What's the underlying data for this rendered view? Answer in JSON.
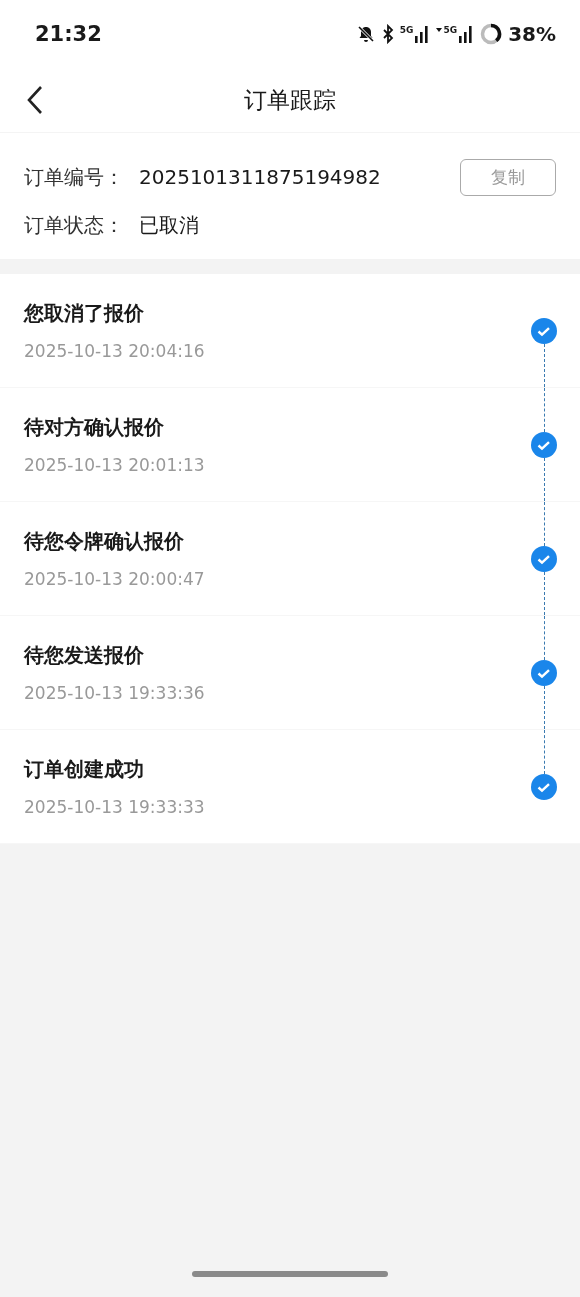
{
  "status_bar": {
    "time": "21:32",
    "network_1": "5G",
    "network_2": "5G",
    "battery": "38%"
  },
  "nav": {
    "title": "订单跟踪"
  },
  "order": {
    "number_label": "订单编号：",
    "number": "2025101311875194982",
    "copy_button": "复制",
    "status_label": "订单状态：",
    "status": "已取消"
  },
  "steps": [
    {
      "title": "您取消了报价",
      "time": "2025-10-13 20:04:16",
      "completed": true
    },
    {
      "title": "待对方确认报价",
      "time": "2025-10-13 20:01:13",
      "completed": true
    },
    {
      "title": "待您令牌确认报价",
      "time": "2025-10-13 20:00:47",
      "completed": true
    },
    {
      "title": "待您发送报价",
      "time": "2025-10-13 19:33:36",
      "completed": true
    },
    {
      "title": "订单创建成功",
      "time": "2025-10-13 19:33:33",
      "completed": true
    }
  ]
}
